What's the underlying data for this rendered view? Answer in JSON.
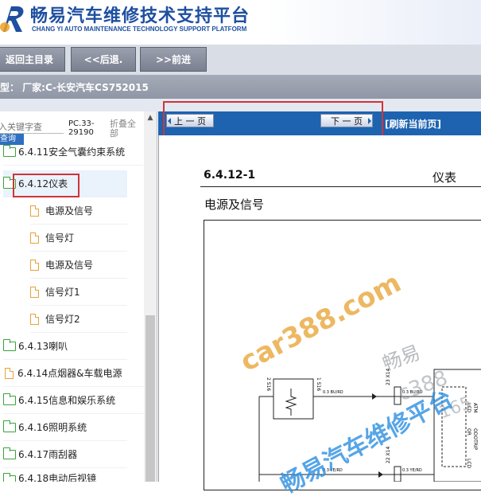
{
  "header": {
    "title_cn": "畅易汽车维修技术支持平台",
    "title_en": "CHANG YI AUTO MAINTENANCE TECHNOLOGY SUPPORT PLATFORM"
  },
  "nav": {
    "home": "返回主目录",
    "back": "<<后退.",
    "forward": ">>前进"
  },
  "model_line": "型：  厂家:C-长安汽车CS752015",
  "sidebar": {
    "search_placeholder": "入关键字查",
    "search_button": "查询",
    "pc_code": "PC.33-29190",
    "collapse_all": "折叠全部",
    "items": [
      {
        "label": "6.4.11安全气囊约束系统",
        "type": "folder"
      },
      {
        "label": "6.4.12仪表",
        "type": "folder",
        "selected": true
      },
      {
        "label": "电源及信号",
        "type": "doc"
      },
      {
        "label": "信号灯",
        "type": "doc"
      },
      {
        "label": "电源及信号",
        "type": "doc"
      },
      {
        "label": "信号灯1",
        "type": "doc"
      },
      {
        "label": "信号灯2",
        "type": "doc"
      },
      {
        "label": "6.4.13喇叭",
        "type": "folder"
      },
      {
        "label": "6.4.14点烟器&车载电源",
        "type": "doc"
      },
      {
        "label": "6.4.15信息和娱乐系统",
        "type": "folder"
      },
      {
        "label": "6.4.16照明系统",
        "type": "folder"
      },
      {
        "label": "6.4.17雨刮器",
        "type": "folder"
      },
      {
        "label": "6.4.18电动后视镜",
        "type": "folder"
      }
    ]
  },
  "content": {
    "prev_page": "上 一 页",
    "next_page": "下 一 页",
    "refresh": "[刷新当前页]",
    "section_no": "6.4.12-1",
    "section_title": "仪表",
    "sub_title": "电源及信号"
  },
  "watermarks": {
    "site": "car388.com",
    "brand": "畅易",
    "code": "c388",
    "num": "165",
    "platform": "畅易汽车维修平台"
  },
  "diagram": {
    "labels": [
      "2 S16",
      "1 S16",
      "0.3 BU/RD",
      "0.3 BU/RD",
      "23 X14",
      "22 X14",
      "0.3 YE/RD",
      "0.3 YE/RD",
      "LCD",
      "ATM",
      "OR",
      "ODOTRIP",
      "LCD"
    ]
  },
  "colors": {
    "brand_blue": "#1e4fa0",
    "toolbar_blue": "#1d63b0",
    "highlight_red": "#d0343a",
    "folder_green": "#3aa33a",
    "doc_orange": "#e7a23a"
  }
}
